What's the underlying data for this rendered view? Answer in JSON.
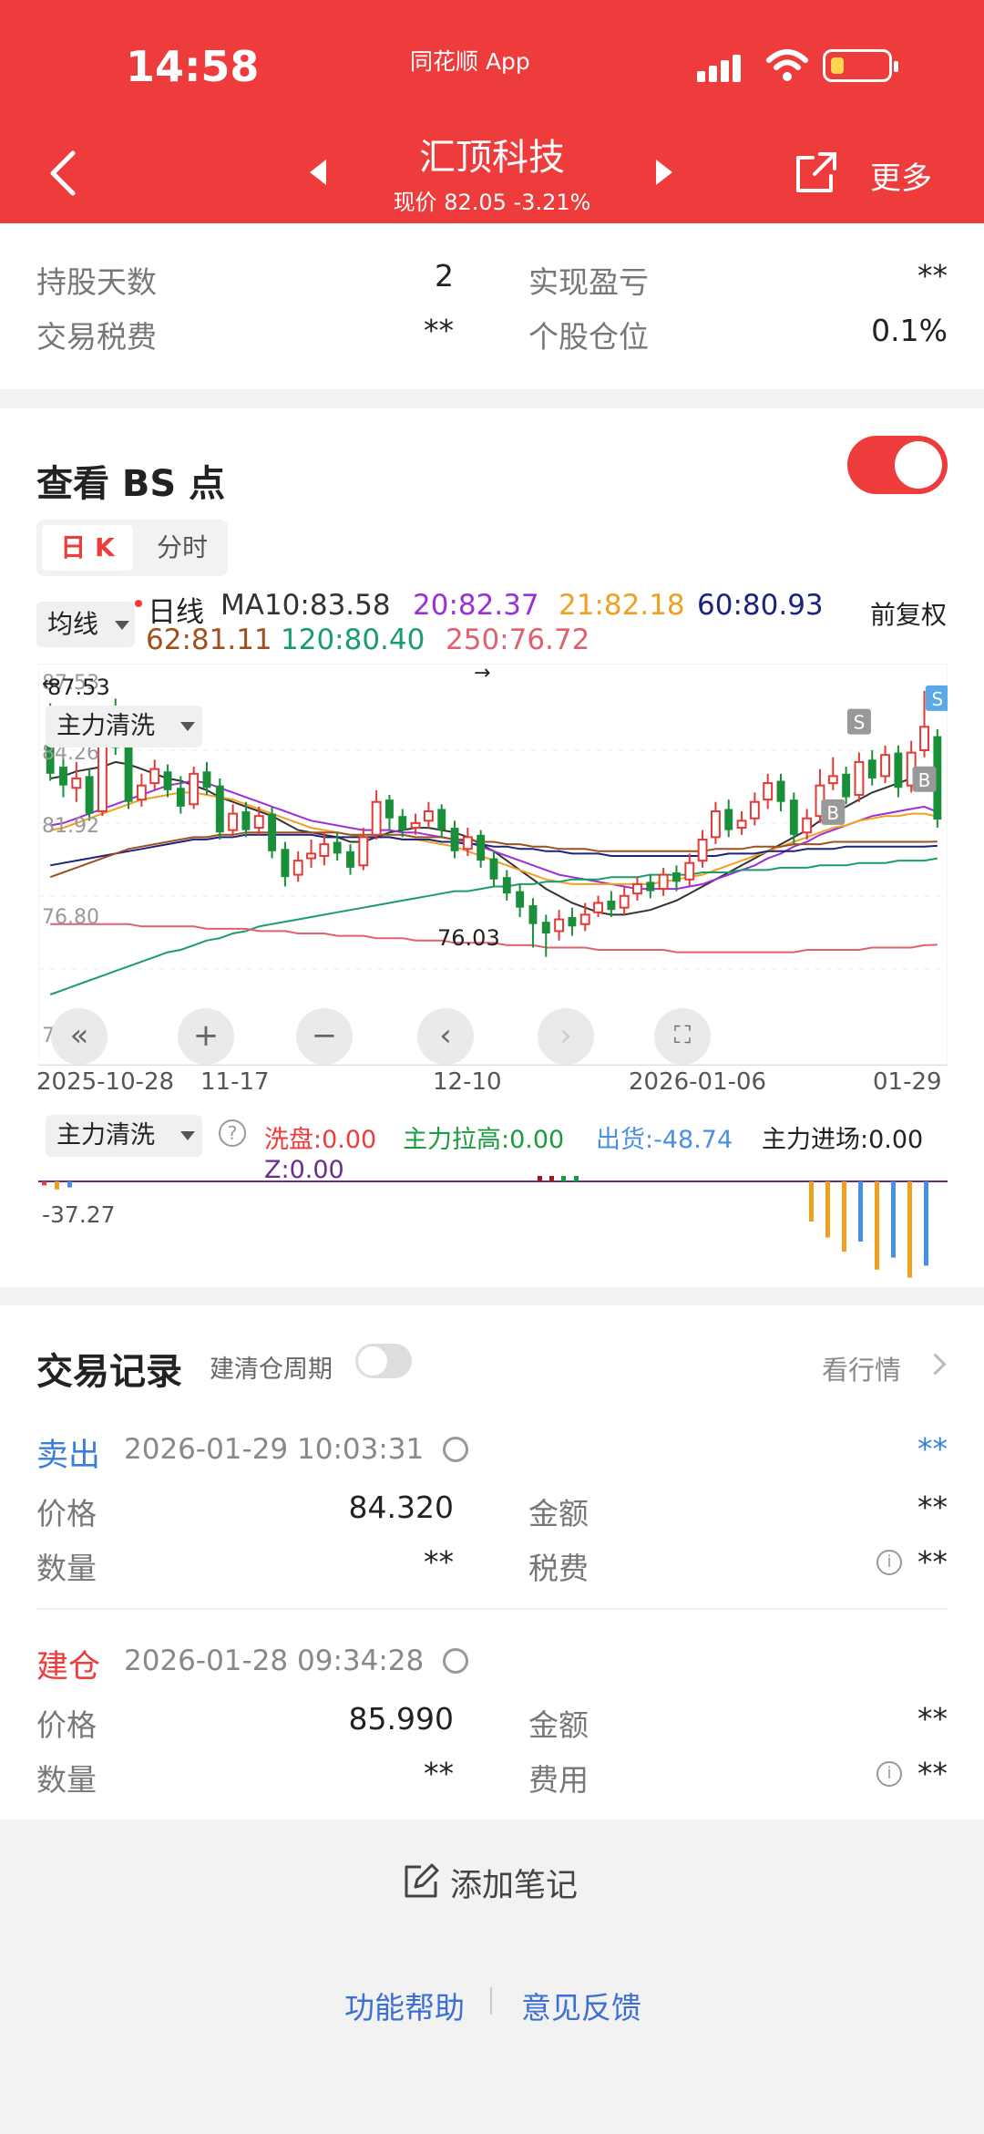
{
  "status_bar": {
    "time": "14:58",
    "app_label": "同花顺 App"
  },
  "header": {
    "title": "汇顶科技",
    "subtitle": "现价 82.05 -3.21%",
    "more_label": "更多"
  },
  "summary": {
    "hold_days_label": "持股天数",
    "hold_days_value": "2",
    "realized_label": "实现盈亏",
    "realized_value": "**",
    "tax_label": "交易税费",
    "tax_value": "**",
    "position_label": "个股仓位",
    "position_value": "0.1%"
  },
  "bs": {
    "title": "查看 BS 点",
    "tab_day": "日 K",
    "tab_time": "分时",
    "ma_button": "均线",
    "ma_legend": [
      {
        "text": "日线",
        "color": "#222222"
      },
      {
        "text": "MA10:83.58",
        "color": "#333333"
      },
      {
        "text": "20:82.37",
        "color": "#9b30d9"
      },
      {
        "text": "21:82.18",
        "color": "#f0a020"
      },
      {
        "text": "60:80.93",
        "color": "#1a237e"
      },
      {
        "text": "62:81.11",
        "color": "#a0501e"
      },
      {
        "text": "120:80.40",
        "color": "#1a9c6e"
      },
      {
        "text": "250:76.72",
        "color": "#e06070"
      }
    ],
    "adjust_label": "前复权"
  },
  "chart_data": {
    "type": "candlestick",
    "y_labels": [
      "87.53",
      "84.26",
      "81.92",
      "76.80",
      "72.58"
    ],
    "high_marker": "87.53",
    "low_marker": "76.03",
    "x_labels": [
      "2025-10-28",
      "11-17",
      "12-10",
      "2026-01-06",
      "01-29"
    ],
    "candles": [
      [
        86.5,
        84.0,
        87.0,
        83.7
      ],
      [
        84.3,
        83.5,
        85.0,
        83.0
      ],
      [
        83.4,
        83.8,
        84.5,
        82.8
      ],
      [
        83.9,
        82.3,
        84.2,
        82.0
      ],
      [
        82.4,
        86.2,
        86.8,
        82.2
      ],
      [
        86.4,
        85.1,
        87.2,
        84.8
      ],
      [
        85.2,
        82.8,
        85.6,
        82.5
      ],
      [
        82.9,
        83.5,
        84.0,
        82.6
      ],
      [
        83.6,
        84.2,
        84.6,
        83.3
      ],
      [
        84.1,
        83.3,
        84.4,
        83.0
      ],
      [
        83.4,
        82.6,
        83.9,
        82.3
      ],
      [
        82.7,
        84.0,
        84.3,
        82.5
      ],
      [
        84.1,
        83.4,
        84.5,
        83.1
      ],
      [
        83.5,
        81.5,
        83.8,
        81.2
      ],
      [
        81.6,
        82.3,
        82.7,
        81.3
      ],
      [
        82.4,
        81.6,
        82.8,
        81.3
      ],
      [
        81.7,
        82.2,
        82.6,
        81.4
      ],
      [
        82.3,
        80.7,
        82.6,
        80.4
      ],
      [
        80.8,
        79.6,
        81.1,
        79.2
      ],
      [
        79.7,
        80.3,
        80.7,
        79.4
      ],
      [
        80.4,
        80.6,
        81.2,
        80.0
      ],
      [
        80.5,
        81.0,
        81.5,
        80.1
      ],
      [
        81.1,
        80.6,
        81.5,
        80.3
      ],
      [
        80.7,
        80.0,
        81.0,
        79.7
      ],
      [
        80.1,
        81.3,
        81.7,
        79.9
      ],
      [
        81.4,
        82.8,
        83.3,
        81.2
      ],
      [
        82.9,
        82.1,
        83.1,
        81.6
      ],
      [
        82.2,
        81.6,
        82.5,
        81.3
      ],
      [
        81.7,
        81.9,
        82.3,
        81.4
      ],
      [
        82.0,
        82.4,
        82.8,
        81.7
      ],
      [
        82.5,
        81.6,
        82.7,
        81.3
      ],
      [
        81.7,
        80.7,
        82.0,
        80.4
      ],
      [
        80.8,
        81.3,
        81.7,
        80.5
      ],
      [
        81.4,
        80.3,
        81.6,
        80.0
      ],
      [
        80.4,
        79.5,
        80.7,
        79.2
      ],
      [
        79.6,
        78.9,
        79.9,
        78.6
      ],
      [
        79.0,
        78.3,
        79.3,
        77.9
      ],
      [
        78.4,
        77.6,
        78.7,
        76.6
      ],
      [
        77.7,
        77.2,
        78.0,
        76.2
      ],
      [
        77.3,
        77.8,
        78.2,
        76.9
      ],
      [
        77.9,
        77.5,
        78.3,
        77.1
      ],
      [
        77.6,
        78.0,
        78.5,
        77.3
      ],
      [
        78.1,
        78.5,
        78.8,
        77.9
      ],
      [
        78.6,
        78.2,
        79.0,
        77.9
      ],
      [
        78.3,
        78.8,
        79.2,
        78.0
      ],
      [
        78.9,
        79.3,
        79.6,
        78.6
      ],
      [
        79.4,
        79.0,
        79.7,
        78.7
      ],
      [
        79.1,
        79.7,
        80.0,
        78.8
      ],
      [
        79.8,
        79.4,
        80.1,
        79.0
      ],
      [
        79.5,
        80.2,
        80.6,
        79.2
      ],
      [
        80.3,
        81.2,
        81.6,
        80.0
      ],
      [
        81.3,
        82.4,
        82.8,
        81.0
      ],
      [
        82.5,
        81.6,
        82.9,
        81.3
      ],
      [
        81.7,
        82.0,
        82.4,
        81.4
      ],
      [
        82.1,
        82.8,
        83.2,
        81.8
      ],
      [
        82.9,
        83.6,
        84.0,
        82.5
      ],
      [
        83.7,
        82.8,
        84.0,
        82.4
      ],
      [
        82.9,
        81.4,
        83.2,
        81.0
      ],
      [
        81.5,
        82.1,
        82.5,
        81.2
      ],
      [
        82.2,
        83.5,
        84.2,
        81.9
      ],
      [
        83.6,
        83.9,
        84.7,
        83.3
      ],
      [
        84.0,
        83.0,
        84.3,
        82.7
      ],
      [
        83.1,
        84.5,
        84.9,
        82.8
      ],
      [
        84.6,
        83.8,
        85.0,
        83.5
      ],
      [
        83.9,
        84.8,
        85.2,
        83.6
      ],
      [
        84.9,
        83.4,
        85.2,
        83.0
      ],
      [
        83.5,
        84.9,
        85.4,
        83.2
      ],
      [
        85.0,
        86.0,
        87.53,
        84.7
      ],
      [
        85.6,
        82.05,
        85.9,
        81.7
      ]
    ],
    "ma_series": [
      {
        "name": "MA10",
        "values": [
          83.8,
          83.9,
          84.1,
          84.2,
          84.3,
          84.5,
          84.4,
          84.2,
          84.0,
          83.8,
          83.7,
          83.5,
          83.3,
          83.0,
          82.8,
          82.6,
          82.4,
          82.2,
          81.9,
          81.6,
          81.5,
          81.4,
          81.3,
          81.1,
          81.1,
          81.3,
          81.5,
          81.6,
          81.7,
          81.7,
          81.6,
          81.5,
          81.3,
          81.0,
          80.7,
          80.3,
          79.9,
          79.5,
          79.1,
          78.8,
          78.5,
          78.3,
          78.1,
          78.0,
          78.0,
          78.1,
          78.2,
          78.4,
          78.6,
          78.9,
          79.2,
          79.5,
          79.8,
          80.1,
          80.4,
          80.7,
          81.0,
          81.3,
          81.6,
          82.0,
          82.3,
          82.6,
          82.9,
          83.2,
          83.4,
          83.6,
          83.8,
          84.0,
          83.58
        ]
      },
      {
        "name": "MA20",
        "values": [
          81.8,
          81.9,
          82.1,
          82.3,
          82.5,
          82.7,
          82.9,
          83.1,
          83.3,
          83.5,
          83.6,
          83.7,
          83.6,
          83.4,
          83.2,
          83.0,
          82.8,
          82.6,
          82.4,
          82.2,
          82.0,
          81.9,
          81.8,
          81.7,
          81.6,
          81.6,
          81.6,
          81.5,
          81.5,
          81.4,
          81.3,
          81.2,
          81.1,
          80.9,
          80.7,
          80.5,
          80.3,
          80.1,
          79.9,
          79.7,
          79.6,
          79.5,
          79.4,
          79.3,
          79.2,
          79.1,
          79.1,
          79.1,
          79.1,
          79.2,
          79.3,
          79.5,
          79.7,
          79.9,
          80.1,
          80.4,
          80.6,
          80.9,
          81.1,
          81.4,
          81.6,
          81.8,
          82.0,
          82.2,
          82.3,
          82.4,
          82.5,
          82.6,
          82.37
        ]
      },
      {
        "name": "MA21",
        "values": [
          81.6,
          81.7,
          81.9,
          82.1,
          82.3,
          82.5,
          82.7,
          82.9,
          83.0,
          83.1,
          83.2,
          83.2,
          83.1,
          83.0,
          82.9,
          82.7,
          82.5,
          82.3,
          82.1,
          81.9,
          81.7,
          81.6,
          81.5,
          81.4,
          81.3,
          81.3,
          81.3,
          81.2,
          81.2,
          81.1,
          81.0,
          80.9,
          80.7,
          80.5,
          80.3,
          80.1,
          79.9,
          79.7,
          79.5,
          79.4,
          79.3,
          79.3,
          79.3,
          79.3,
          79.3,
          79.3,
          79.3,
          79.4,
          79.5,
          79.6,
          79.7,
          79.9,
          80.1,
          80.3,
          80.5,
          80.7,
          80.9,
          81.1,
          81.3,
          81.5,
          81.7,
          81.8,
          82.0,
          82.1,
          82.2,
          82.2,
          82.3,
          82.3,
          82.18
        ]
      },
      {
        "name": "MA60",
        "values": [
          80.1,
          80.2,
          80.3,
          80.4,
          80.5,
          80.6,
          80.7,
          80.8,
          80.9,
          81.0,
          81.1,
          81.2,
          81.2,
          81.3,
          81.3,
          81.4,
          81.4,
          81.4,
          81.4,
          81.4,
          81.4,
          81.3,
          81.3,
          81.3,
          81.3,
          81.3,
          81.3,
          81.2,
          81.2,
          81.2,
          81.1,
          81.1,
          81.0,
          81.0,
          80.9,
          80.9,
          80.8,
          80.8,
          80.7,
          80.7,
          80.6,
          80.6,
          80.6,
          80.5,
          80.5,
          80.5,
          80.5,
          80.5,
          80.5,
          80.5,
          80.5,
          80.5,
          80.6,
          80.6,
          80.6,
          80.7,
          80.7,
          80.7,
          80.8,
          80.8,
          80.8,
          80.9,
          80.9,
          80.9,
          80.9,
          80.9,
          80.9,
          80.9,
          80.93
        ]
      },
      {
        "name": "MA62",
        "values": [
          79.6,
          79.8,
          80.0,
          80.2,
          80.4,
          80.6,
          80.8,
          80.9,
          81.0,
          81.1,
          81.2,
          81.3,
          81.3,
          81.4,
          81.4,
          81.5,
          81.5,
          81.5,
          81.5,
          81.5,
          81.5,
          81.5,
          81.5,
          81.4,
          81.4,
          81.4,
          81.4,
          81.4,
          81.3,
          81.3,
          81.3,
          81.2,
          81.2,
          81.1,
          81.1,
          81.0,
          81.0,
          80.9,
          80.9,
          80.8,
          80.8,
          80.8,
          80.7,
          80.7,
          80.7,
          80.7,
          80.7,
          80.7,
          80.7,
          80.7,
          80.7,
          80.8,
          80.8,
          80.8,
          80.9,
          80.9,
          80.9,
          81.0,
          81.0,
          81.0,
          81.1,
          81.1,
          81.1,
          81.1,
          81.1,
          81.1,
          81.1,
          81.1,
          81.11
        ]
      },
      {
        "name": "MA120",
        "values": [
          74.6,
          74.8,
          75.0,
          75.2,
          75.4,
          75.6,
          75.8,
          76.0,
          76.2,
          76.4,
          76.5,
          76.7,
          76.9,
          77.0,
          77.2,
          77.3,
          77.5,
          77.6,
          77.7,
          77.8,
          77.9,
          78.0,
          78.1,
          78.2,
          78.3,
          78.4,
          78.5,
          78.6,
          78.7,
          78.8,
          78.9,
          79.0,
          79.0,
          79.1,
          79.2,
          79.2,
          79.3,
          79.3,
          79.4,
          79.4,
          79.5,
          79.5,
          79.5,
          79.6,
          79.6,
          79.6,
          79.7,
          79.7,
          79.7,
          79.7,
          79.8,
          79.8,
          79.8,
          79.9,
          79.9,
          79.9,
          80.0,
          80.0,
          80.0,
          80.1,
          80.1,
          80.1,
          80.2,
          80.2,
          80.2,
          80.3,
          80.3,
          80.3,
          80.4
        ]
      },
      {
        "name": "MA250",
        "values": [
          77.6,
          77.6,
          77.6,
          77.6,
          77.6,
          77.6,
          77.6,
          77.5,
          77.5,
          77.5,
          77.5,
          77.5,
          77.4,
          77.4,
          77.4,
          77.4,
          77.3,
          77.3,
          77.3,
          77.2,
          77.2,
          77.2,
          77.1,
          77.1,
          77.1,
          77.0,
          77.0,
          77.0,
          76.9,
          76.9,
          76.9,
          76.8,
          76.8,
          76.8,
          76.8,
          76.7,
          76.7,
          76.7,
          76.6,
          76.6,
          76.6,
          76.6,
          76.5,
          76.5,
          76.5,
          76.5,
          76.5,
          76.5,
          76.4,
          76.4,
          76.4,
          76.4,
          76.4,
          76.4,
          76.4,
          76.4,
          76.4,
          76.4,
          76.5,
          76.5,
          76.5,
          76.5,
          76.5,
          76.6,
          76.6,
          76.6,
          76.6,
          76.7,
          76.72
        ]
      }
    ],
    "bs_markers": [
      {
        "label": "S",
        "index": 62
      },
      {
        "label": "B",
        "index": 60
      },
      {
        "label": "B",
        "index": 67
      },
      {
        "label": "S",
        "index": 68
      }
    ]
  },
  "indicator": {
    "button": "主力清洗",
    "help": "?",
    "xipan": "洗盘:0.00",
    "lagao": "主力拉高:0.00",
    "chuhuo": "出货:-48.74",
    "jinchang": "主力进场:0.00",
    "z": "Z:0.00",
    "level": "-37.27",
    "bars": [
      {
        "v": -2,
        "c": "#ee3b3b"
      },
      {
        "v": -4,
        "c": "#f0a020"
      },
      {
        "v": -3,
        "c": "#4a90e2"
      },
      {
        "v": 8,
        "c": "#9b1b1b"
      },
      {
        "v": 14,
        "c": "#9b1b1b"
      },
      {
        "v": 6,
        "c": "#1a9c3e"
      },
      {
        "v": 4,
        "c": "#1a9c3e"
      },
      {
        "v": -20,
        "c": "#f0a020"
      },
      {
        "v": -28,
        "c": "#f0a020"
      },
      {
        "v": -35,
        "c": "#f0a020"
      },
      {
        "v": -30,
        "c": "#4a90e2"
      },
      {
        "v": -44,
        "c": "#f0a020"
      },
      {
        "v": -38,
        "c": "#4a90e2"
      },
      {
        "v": -48,
        "c": "#f0a020"
      },
      {
        "v": -42,
        "c": "#4a90e2"
      }
    ]
  },
  "records": {
    "title": "交易记录",
    "period_label": "建清仓周期",
    "view_label": "看行情",
    "items": [
      {
        "side": "卖出",
        "side_color": "#3b7ddd",
        "datetime": "2026-01-29 10:03:31",
        "top_right": "**",
        "price_label": "价格",
        "price_value": "84.320",
        "amount_label": "金额",
        "amount_value": "**",
        "qty_label": "数量",
        "qty_value": "**",
        "fee_label": "税费",
        "fee_value": "**"
      },
      {
        "side": "建仓",
        "side_color": "#ee3b3b",
        "datetime": "2026-01-28 09:34:28",
        "top_right": "",
        "price_label": "价格",
        "price_value": "85.990",
        "amount_label": "金额",
        "amount_value": "**",
        "qty_label": "数量",
        "qty_value": "**",
        "fee_label": "费用",
        "fee_value": "**"
      }
    ]
  },
  "footer": {
    "add_note": "添加笔记",
    "help": "功能帮助",
    "feedback": "意见反馈"
  }
}
